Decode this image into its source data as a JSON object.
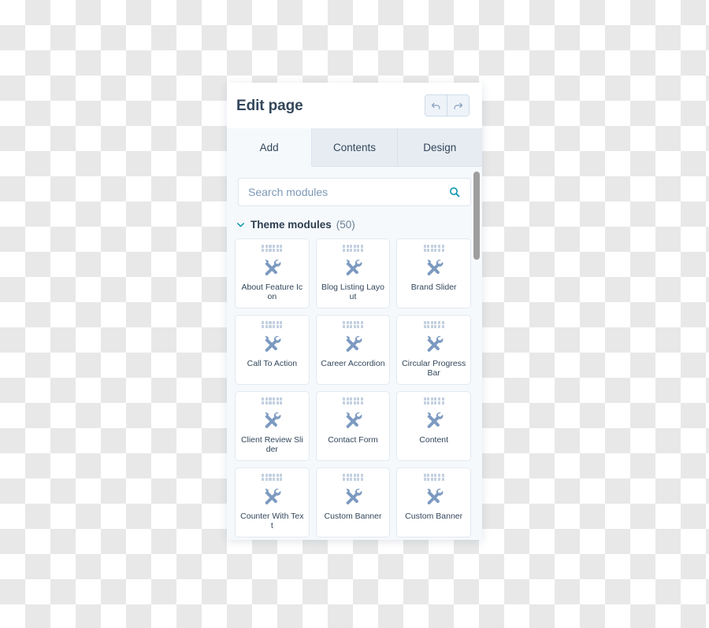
{
  "header": {
    "title": "Edit page",
    "undo_label": "Undo",
    "redo_label": "Redo"
  },
  "tabs": [
    {
      "label": "Add",
      "active": true
    },
    {
      "label": "Contents",
      "active": false
    },
    {
      "label": "Design",
      "active": false
    }
  ],
  "search": {
    "placeholder": "Search modules",
    "value": "",
    "icon": "search-icon"
  },
  "section": {
    "title": "Theme modules",
    "count": "(50)",
    "expanded": true,
    "chevron_icon": "chevron-down-icon"
  },
  "modules": [
    {
      "label": "About Feature Icon",
      "icon": "tools-icon"
    },
    {
      "label": "Blog Listing Layout",
      "icon": "tools-icon"
    },
    {
      "label": "Brand Slider",
      "icon": "tools-icon"
    },
    {
      "label": "Call To Action",
      "icon": "tools-icon"
    },
    {
      "label": "Career Accordion",
      "icon": "tools-icon"
    },
    {
      "label": "Circular Progress Bar",
      "icon": "tools-icon"
    },
    {
      "label": "Client Review Slider",
      "icon": "tools-icon"
    },
    {
      "label": "Contact Form",
      "icon": "tools-icon"
    },
    {
      "label": "Content",
      "icon": "tools-icon"
    },
    {
      "label": "Counter With Text",
      "icon": "tools-icon"
    },
    {
      "label": "Custom Banner",
      "icon": "tools-icon"
    },
    {
      "label": "Custom Banner",
      "icon": "tools-icon"
    }
  ],
  "colors": {
    "accent": "#0091ae",
    "text_dark": "#33475b",
    "panel_bg": "#f6f9fc",
    "tab_inactive": "#e7ecf3",
    "icon_blue": "#7c9ac0",
    "scrollbar": "#9e9e9e"
  }
}
